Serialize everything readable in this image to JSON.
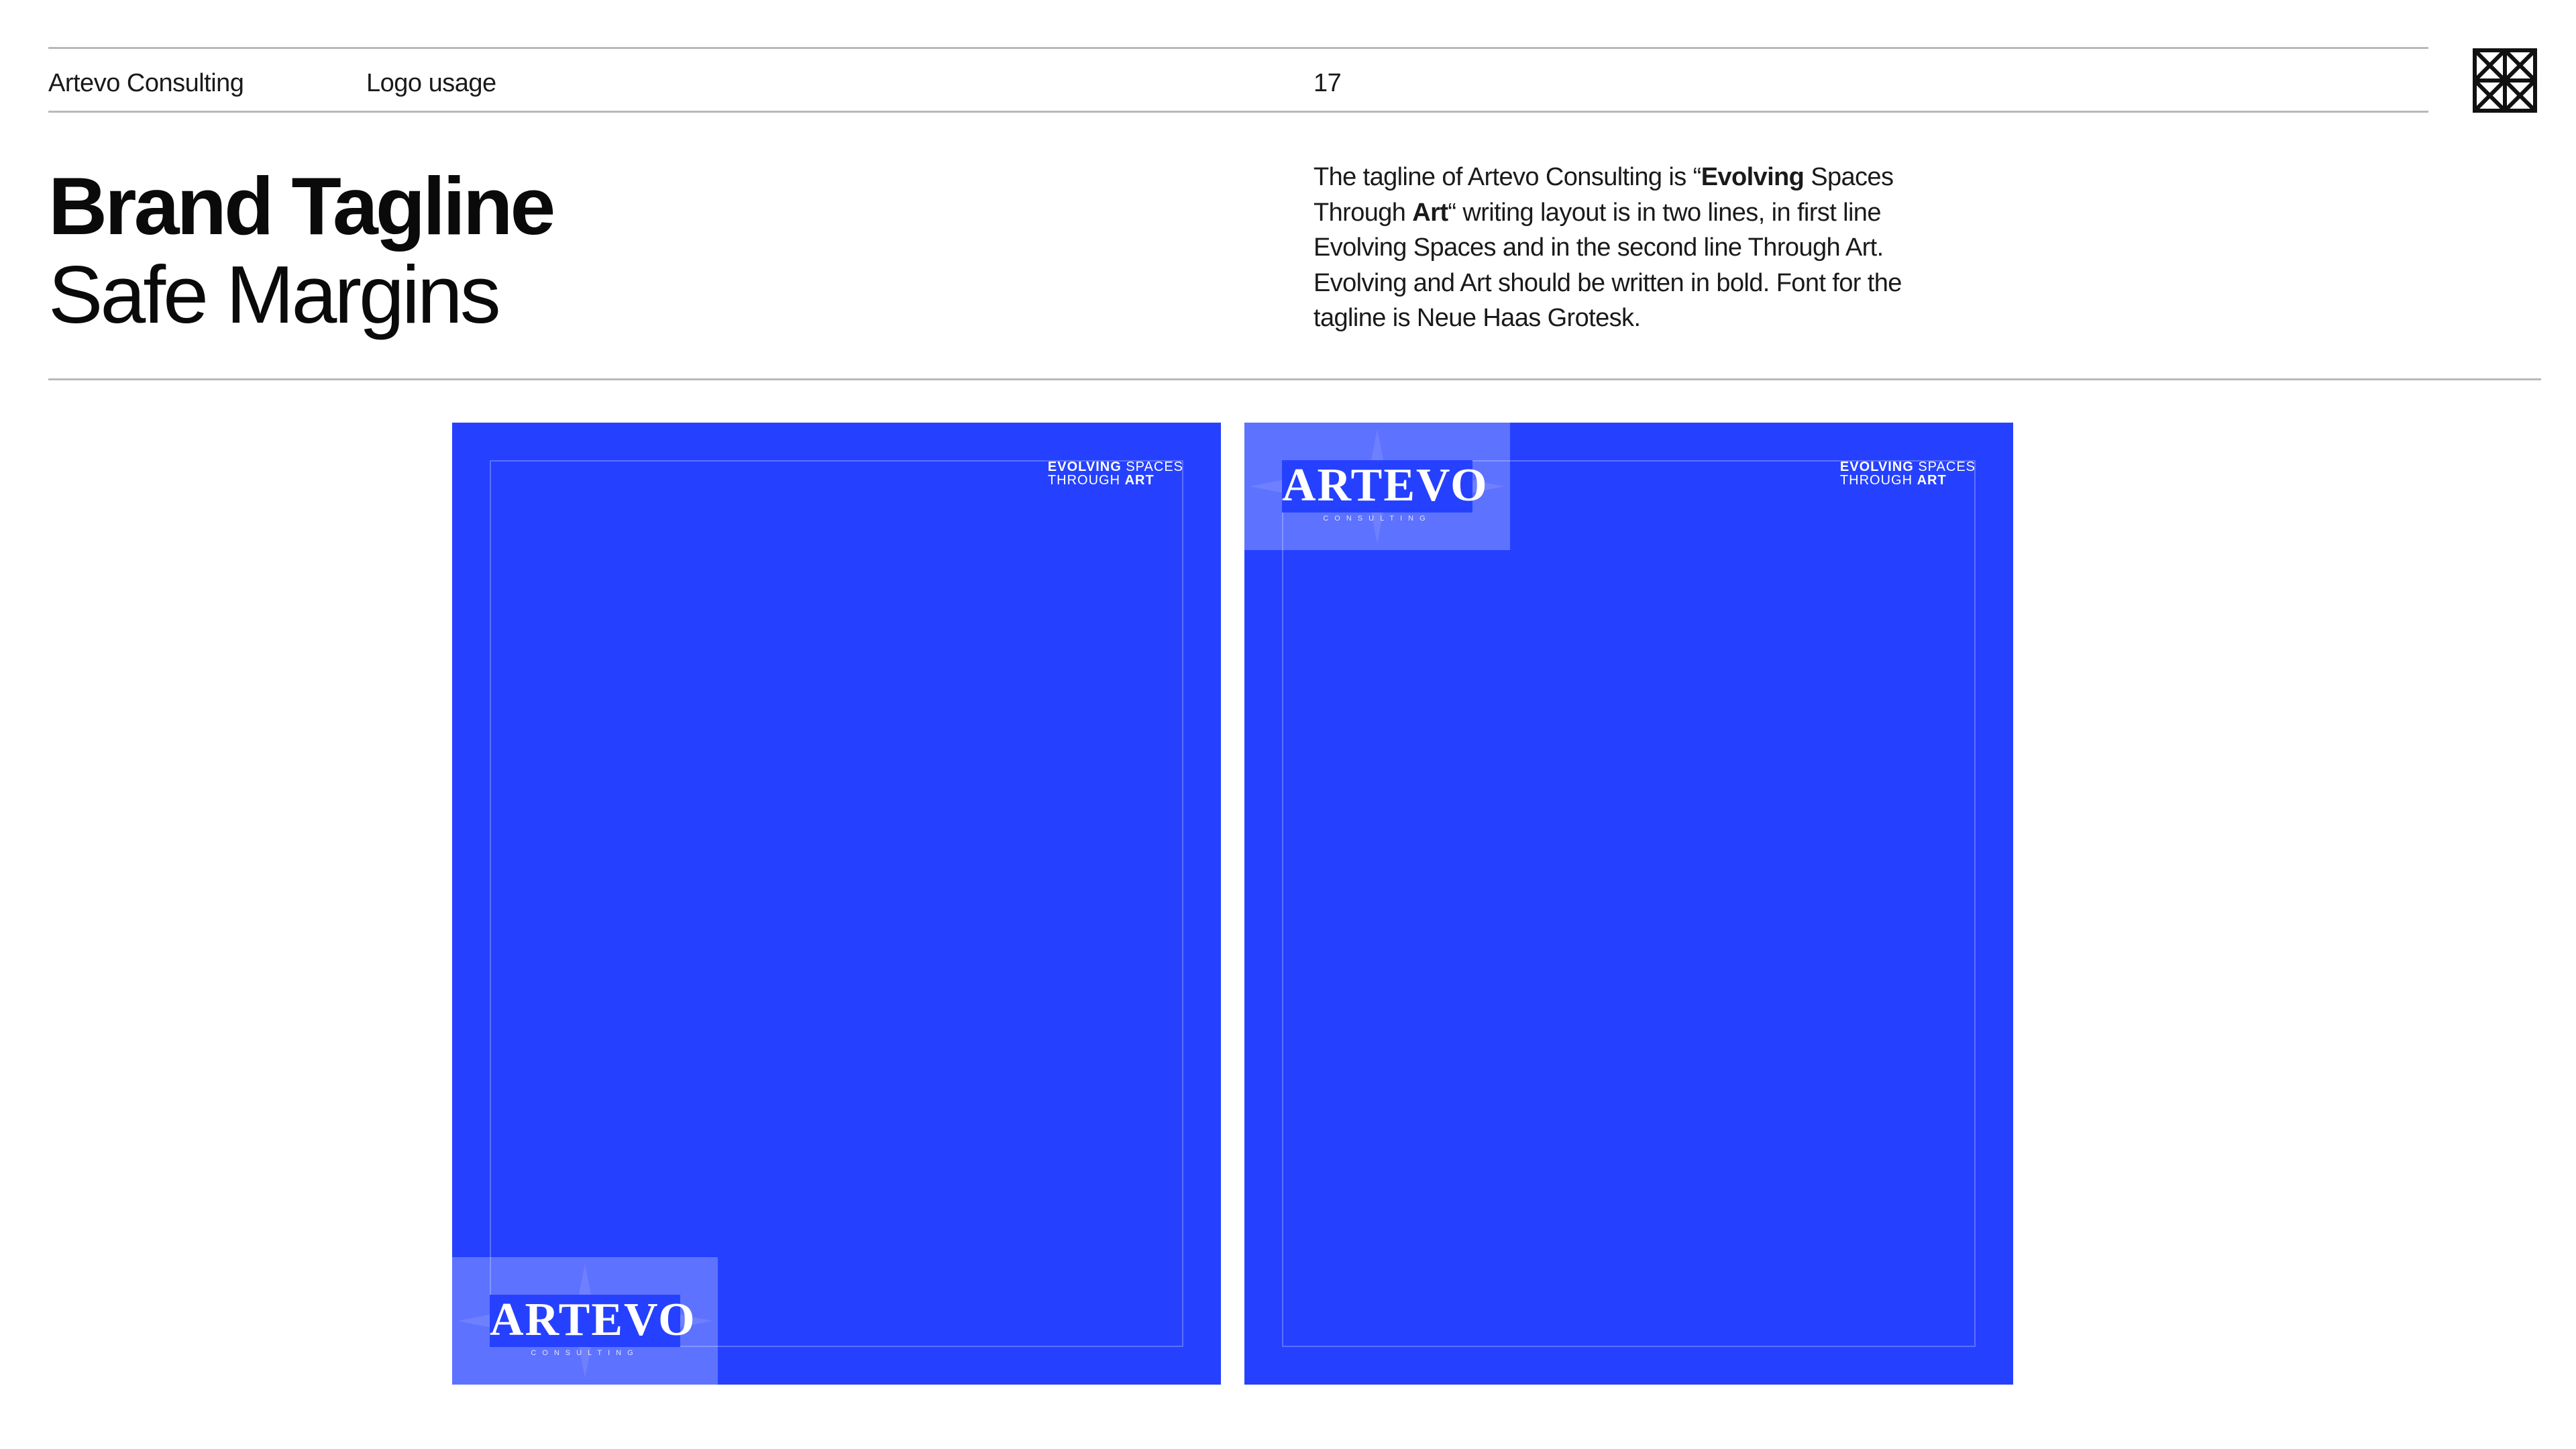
{
  "header": {
    "company": "Artevo Consulting",
    "section": "Logo usage",
    "page_number": "17",
    "mark_icon": "grid-star-mark-icon"
  },
  "title": {
    "bold": "Brand Tagline",
    "light": "Safe Margins"
  },
  "description": {
    "part1": "The tagline of Artevo Consulting is “",
    "bold1": "Evolving",
    "part2": " Spaces Through ",
    "bold2": "Art",
    "part3": "“ writing layout is in two lines, in first line Evolving Spaces and in the second line Through Art. Evolving and Art should be written in bold. Font for the tagline is Neue Haas Grotesk."
  },
  "mockups": [
    {
      "tagline": {
        "line1_bold": "EVOLVING",
        "line1_regular": " SPACES",
        "line2_regular": "THROUGH ",
        "line2_bold": "ART"
      },
      "logo": {
        "wordmark": "ARTEVO",
        "subtitle": "CONSULTING",
        "position": "bottom-left"
      }
    },
    {
      "tagline": {
        "line1_bold": "EVOLVING",
        "line1_regular": " SPACES",
        "line2_regular": "THROUGH ",
        "line2_bold": "ART"
      },
      "logo": {
        "wordmark": "ARTEVO",
        "subtitle": "CONSULTING",
        "position": "top-left"
      }
    }
  ],
  "colors": {
    "brand_blue": "#2541ff",
    "rule_gray": "#b9b9b9",
    "text": "#111111"
  }
}
